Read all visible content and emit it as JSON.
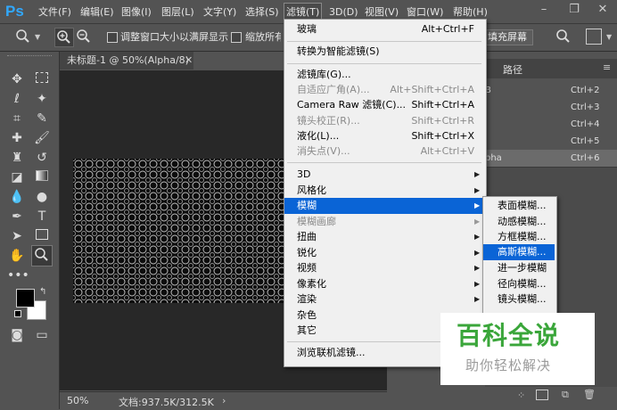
{
  "app": {
    "logo": "Ps"
  },
  "menubar": {
    "items": [
      "文件(F)",
      "编辑(E)",
      "图像(I)",
      "图层(L)",
      "文字(Y)",
      "选择(S)",
      "滤镜(T)",
      "3D(D)",
      "视图(V)",
      "窗口(W)",
      "帮助(H)"
    ],
    "window_controls": [
      "minimize",
      "restore",
      "close"
    ]
  },
  "options_bar": {
    "resize_windows_label": "调整窗口大小以满屏显示",
    "zoom_all_label": "缩放所有",
    "fill_screen_label": "填充屏幕"
  },
  "document": {
    "tab_title": "未标题-1 @ 50%(Alpha/8) *",
    "zoom": "50%",
    "doc_info": "文档:937.5K/312.5K"
  },
  "panels": {
    "tab_paths": "路径",
    "channel_shortcuts": [
      "Ctrl+2",
      "Ctrl+3",
      "Ctrl+4",
      "Ctrl+5",
      "Ctrl+6"
    ],
    "partial_labels": [
      "B",
      "pha"
    ]
  },
  "filter_menu": {
    "items": [
      {
        "label": "玻璃",
        "shortcut": "Alt+Ctrl+F",
        "disabled": false
      },
      {
        "label": "转换为智能滤镜(S)",
        "shortcut": "",
        "disabled": false
      },
      {
        "label": "滤镜库(G)...",
        "shortcut": "",
        "disabled": false
      },
      {
        "label": "自适应广角(A)...",
        "shortcut": "Alt+Shift+Ctrl+A",
        "disabled": true
      },
      {
        "label": "Camera Raw 滤镜(C)...",
        "shortcut": "Shift+Ctrl+A",
        "disabled": false
      },
      {
        "label": "镜头校正(R)...",
        "shortcut": "Shift+Ctrl+R",
        "disabled": true
      },
      {
        "label": "液化(L)...",
        "shortcut": "Shift+Ctrl+X",
        "disabled": false
      },
      {
        "label": "消失点(V)...",
        "shortcut": "Alt+Ctrl+V",
        "disabled": true
      },
      {
        "label": "3D",
        "shortcut": "",
        "disabled": false
      },
      {
        "label": "风格化",
        "shortcut": "",
        "disabled": false
      },
      {
        "label": "模糊",
        "shortcut": "",
        "disabled": false
      },
      {
        "label": "模糊画廊",
        "shortcut": "",
        "disabled": true
      },
      {
        "label": "扭曲",
        "shortcut": "",
        "disabled": false
      },
      {
        "label": "锐化",
        "shortcut": "",
        "disabled": false
      },
      {
        "label": "视频",
        "shortcut": "",
        "disabled": false
      },
      {
        "label": "像素化",
        "shortcut": "",
        "disabled": false
      },
      {
        "label": "渲染",
        "shortcut": "",
        "disabled": false
      },
      {
        "label": "杂色",
        "shortcut": "",
        "disabled": false
      },
      {
        "label": "其它",
        "shortcut": "",
        "disabled": false
      },
      {
        "label": "浏览联机滤镜...",
        "shortcut": "",
        "disabled": false
      }
    ]
  },
  "blur_submenu": {
    "items": [
      "表面模糊...",
      "动感模糊...",
      "方框模糊...",
      "高斯模糊...",
      "进一步模糊",
      "径向模糊...",
      "镜头模糊..."
    ]
  },
  "watermark": {
    "title": "百科全说",
    "subtitle": "助你轻松解决"
  },
  "colors": {
    "highlight": "#0a64d6",
    "ui_bg": "#535353",
    "menu_bg": "#f0f0f0",
    "watermark_green": "#3aa63a"
  }
}
